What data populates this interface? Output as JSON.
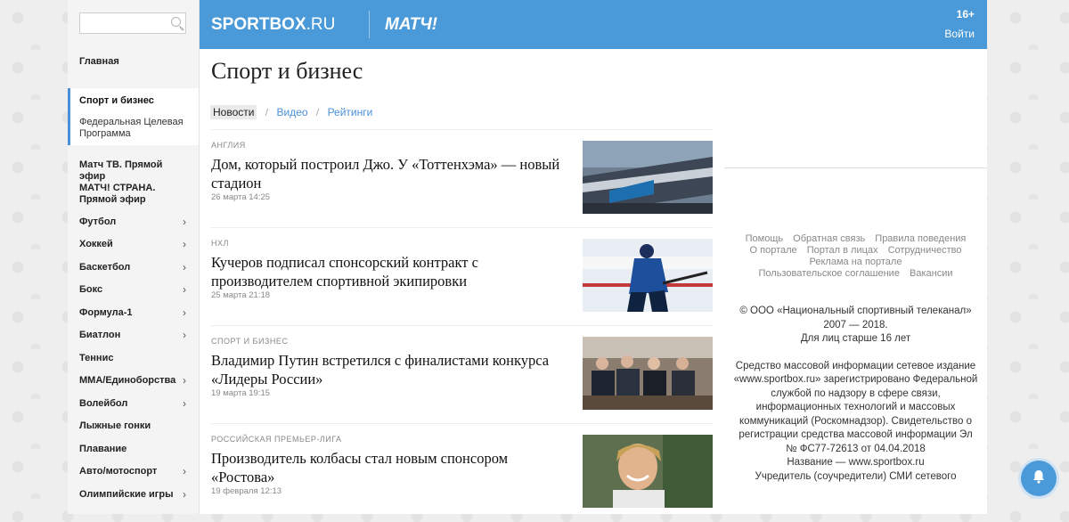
{
  "sidebar": {
    "items": [
      {
        "label": "Главная",
        "chev": false
      },
      {
        "label": "Матч ТВ. Прямой эфир",
        "chev": false
      },
      {
        "label": "МАТЧ! СТРАНА. Прямой эфир",
        "chev": false
      },
      {
        "label": "Футбол",
        "chev": true
      },
      {
        "label": "Хоккей",
        "chev": true
      },
      {
        "label": "Баскетбол",
        "chev": true
      },
      {
        "label": "Бокс",
        "chev": true
      },
      {
        "label": "Формула-1",
        "chev": true
      },
      {
        "label": "Биатлон",
        "chev": true
      },
      {
        "label": "Теннис",
        "chev": false
      },
      {
        "label": "ММА/Единоборства",
        "chev": true
      },
      {
        "label": "Волейбол",
        "chev": true
      },
      {
        "label": "Лыжные гонки",
        "chev": false
      },
      {
        "label": "Плавание",
        "chev": false
      },
      {
        "label": "Авто/мотоспорт",
        "chev": true
      },
      {
        "label": "Олимпийские игры",
        "chev": true
      }
    ],
    "current": "Спорт и бизнес",
    "sub": "Федеральная Целевая Программа",
    "chevron": "›"
  },
  "header": {
    "logo_main": "SPORTBOX",
    "logo_ru": ".RU",
    "logo_match": "МАТЧ!",
    "age": "16+",
    "login": "Войти"
  },
  "main": {
    "title": "Спорт и бизнес",
    "tabs": {
      "news": "Новости",
      "video": "Видео",
      "ratings": "Рейтинги",
      "sep": "/"
    },
    "articles": [
      {
        "cat": "АНГЛИЯ",
        "title": "Дом, который построил Джо. У «Тоттенхэма» — новый стадион",
        "date": "26 марта 14:25"
      },
      {
        "cat": "НХЛ",
        "title": "Кучеров подписал спонсорский контракт с производителем спортивной экипировки",
        "date": "25 марта 21:18"
      },
      {
        "cat": "СПОРТ И БИЗНЕС",
        "title": "Владимир Путин встретился с финалистами конкурса «Лидеры России»",
        "date": "19 марта 19:15"
      },
      {
        "cat": "РОССИЙСКАЯ ПРЕМЬЕР-ЛИГА",
        "title": "Производитель колбасы стал новым спонсором «Ростова»",
        "date": "19 февраля 12:13"
      }
    ]
  },
  "footer": {
    "links_row1": [
      "Помощь",
      "Обратная связь",
      "Правила поведения"
    ],
    "links_row2": [
      "О портале",
      "Портал в лицах",
      "Сотрудничество"
    ],
    "links_row3": [
      "Реклама на портале"
    ],
    "links_row4": [
      "Пользовательское соглашение",
      "Вакансии"
    ],
    "copyright": "© ООО «Национальный спортивный телеканал» 2007 — 2018.",
    "age_note": "Для лиц старше 16 лет",
    "legal": "Средство массовой информации сетевое издание «www.sportbox.ru» зарегистрировано Федеральной службой по надзору в сфере связи, информационных технологий и массовых коммуникаций (Роскомнадзор). Свидетельство о регистрации средства массовой информации Эл № ФС77-72613 от 04.04.2018",
    "name_line": "Название — www.sportbox.ru",
    "founder_line": "Учредитель (соучредители) СМИ сетевого"
  },
  "colors": {
    "accent": "#4a9ad9",
    "active_border": "#4a90d9"
  }
}
